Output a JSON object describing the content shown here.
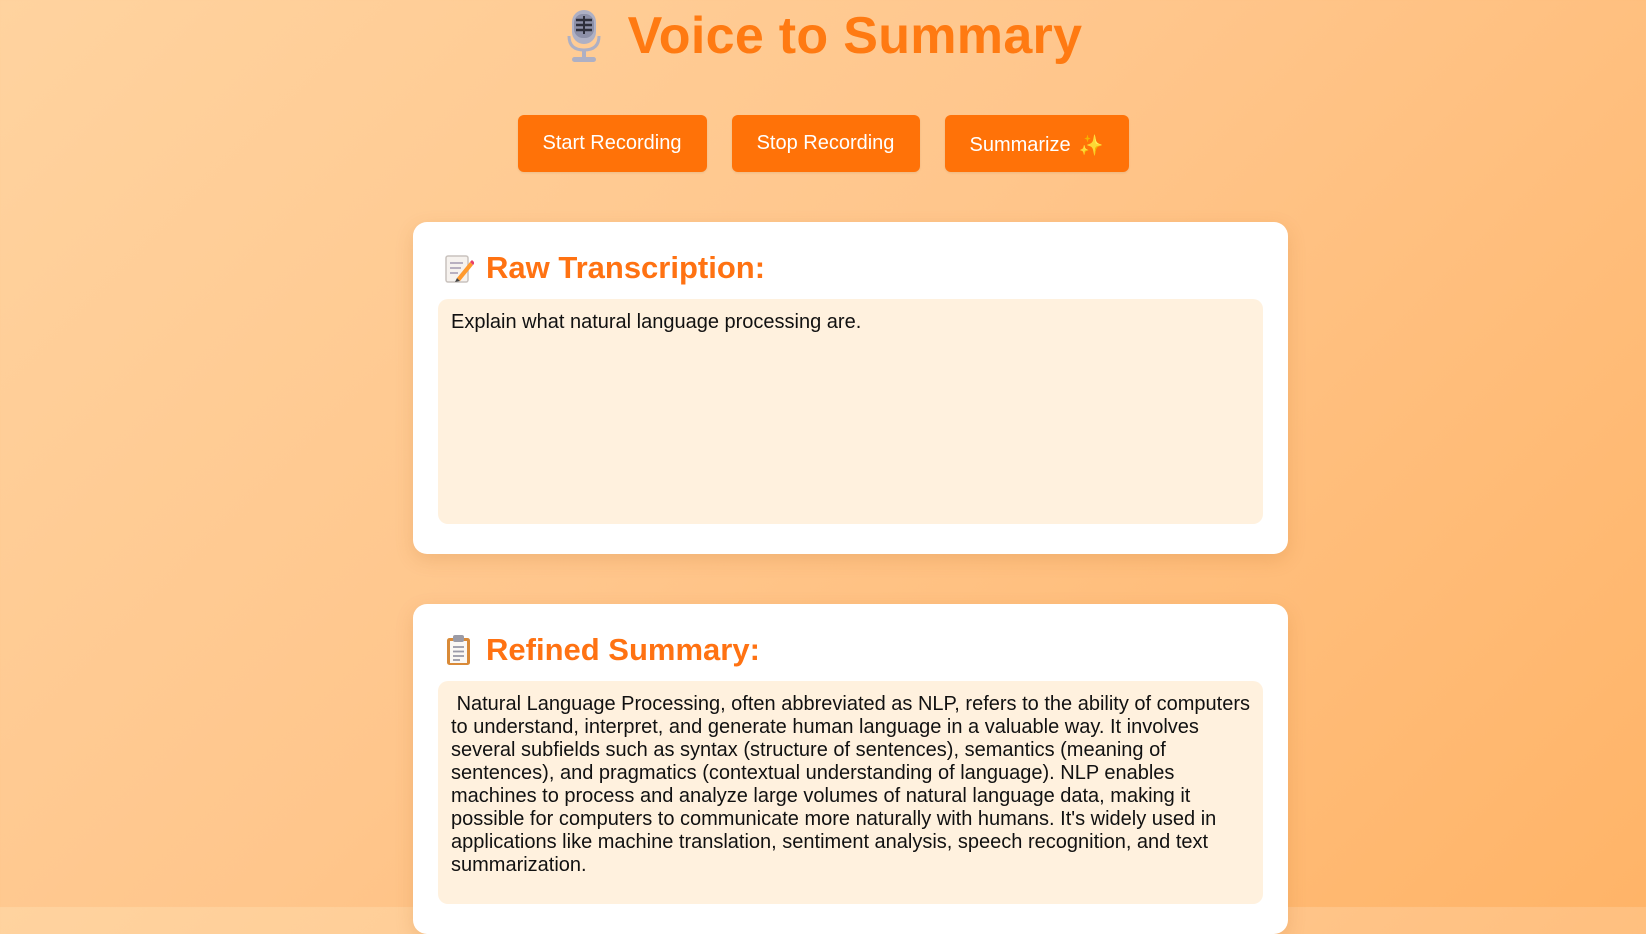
{
  "header": {
    "title": "Voice to Summary",
    "icon": "microphone-icon"
  },
  "controls": {
    "start_label": "Start Recording",
    "stop_label": "Stop Recording",
    "summarize_label": "Summarize",
    "summarize_icon": "✨"
  },
  "raw": {
    "title": "Raw Transcription:",
    "icon": "memo-icon",
    "text": "Explain what natural language processing are."
  },
  "summary": {
    "title": "Refined Summary:",
    "icon": "clipboard-icon",
    "text": " Natural Language Processing, often abbreviated as NLP, refers to the ability of computers to understand, interpret, and generate human language in a valuable way. It involves several subfields such as syntax (structure of sentences), semantics (meaning of sentences), and pragmatics (contextual understanding of language). NLP enables machines to process and analyze large volumes of natural language data, making it possible for computers to communicate more naturally with humans. It's widely used in applications like machine translation, sentiment analysis, speech recognition, and text summarization."
  },
  "colors": {
    "accent": "#ff7208",
    "title": "#ff7a12",
    "textbox_bg": "#fff1de",
    "card_bg": "#ffffff"
  }
}
